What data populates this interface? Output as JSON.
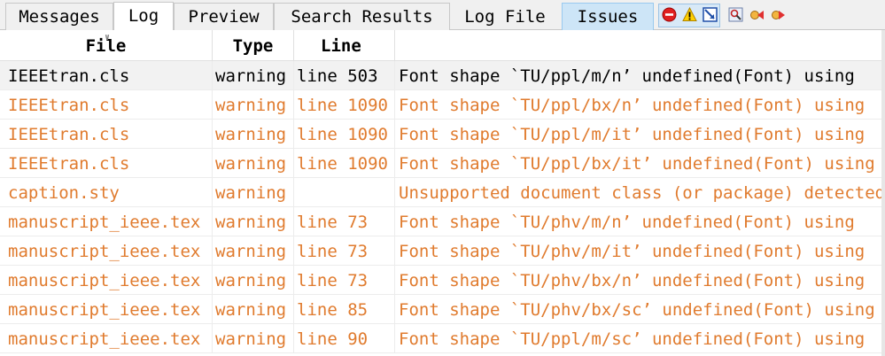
{
  "tabs": [
    {
      "label": "Messages"
    },
    {
      "label": "Log"
    },
    {
      "label": "Preview"
    },
    {
      "label": "Search Results"
    },
    {
      "label": "Log File"
    },
    {
      "label": "Issues"
    }
  ],
  "toolbar_icons": [
    "error-filter-icon",
    "warning-filter-icon",
    "badbox-filter-icon",
    "search-settings-icon",
    "previous-issue-icon",
    "next-issue-icon"
  ],
  "columns": {
    "file": "File",
    "type": "Type",
    "line": "Line",
    "message": ""
  },
  "rows": [
    {
      "file": "IEEEtran.cls",
      "type": "warning",
      "line": "line 503",
      "message": "Font shape `TU/ppl/m/n’ undefined(Font) using"
    },
    {
      "file": "IEEEtran.cls",
      "type": "warning",
      "line": "line 1090",
      "message": "Font shape `TU/ppl/bx/n’ undefined(Font) using"
    },
    {
      "file": "IEEEtran.cls",
      "type": "warning",
      "line": "line 1090",
      "message": "Font shape `TU/ppl/m/it’ undefined(Font) using"
    },
    {
      "file": "IEEEtran.cls",
      "type": "warning",
      "line": "line 1090",
      "message": "Font shape `TU/ppl/bx/it’ undefined(Font) using"
    },
    {
      "file": "caption.sty",
      "type": "warning",
      "line": "",
      "message": "Unsupported document class (or package) detected"
    },
    {
      "file": "manuscript_ieee.tex",
      "type": "warning",
      "line": "line 73",
      "message": "Font shape `TU/phv/m/n’ undefined(Font) using"
    },
    {
      "file": "manuscript_ieee.tex",
      "type": "warning",
      "line": "line 73",
      "message": "Font shape `TU/phv/m/it’ undefined(Font) using"
    },
    {
      "file": "manuscript_ieee.tex",
      "type": "warning",
      "line": "line 73",
      "message": "Font shape `TU/phv/bx/n’ undefined(Font) using"
    },
    {
      "file": "manuscript_ieee.tex",
      "type": "warning",
      "line": "line 85",
      "message": "Font shape `TU/phv/bx/sc’ undefined(Font) using"
    },
    {
      "file": "manuscript_ieee.tex",
      "type": "warning",
      "line": "line 90",
      "message": "Font shape `TU/ppl/m/sc’ undefined(Font) using"
    }
  ],
  "colors": {
    "warning_text": "#e07b2e",
    "selected_text": "#000000",
    "active_tab_highlight": "#cde5f7"
  }
}
